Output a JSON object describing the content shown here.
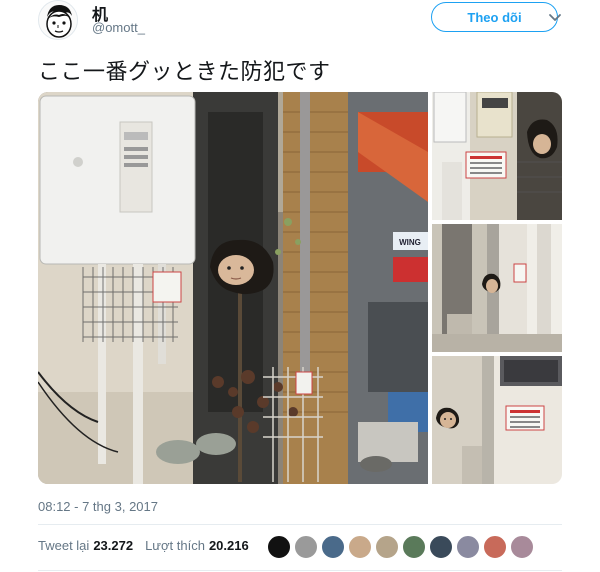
{
  "user": {
    "display_name": "机",
    "handle": "@omott_",
    "avatar_icon": "cartoon-face-avatar"
  },
  "header": {
    "follow_label": "Theo dõi",
    "menu_icon": "chevron-down-icon"
  },
  "tweet": {
    "text": "ここ一番グッときた防犯です",
    "timestamp": "08:12 - 7 thg 3, 2017"
  },
  "media": {
    "sign_text": "WING"
  },
  "stats": {
    "retweets_label": "Tweet lại",
    "retweets_count": "23.272",
    "likes_label": "Lượt thích",
    "likes_count": "20.216"
  },
  "likers": [
    {
      "name": "liker-avatar-1",
      "color": "#111111"
    },
    {
      "name": "liker-avatar-2",
      "color": "#9a9a9a"
    },
    {
      "name": "liker-avatar-3",
      "color": "#4a6a8a"
    },
    {
      "name": "liker-avatar-4",
      "color": "#c9a98a"
    },
    {
      "name": "liker-avatar-5",
      "color": "#b5a48a"
    },
    {
      "name": "liker-avatar-6",
      "color": "#5a7a5a"
    },
    {
      "name": "liker-avatar-7",
      "color": "#3a4a5a"
    },
    {
      "name": "liker-avatar-8",
      "color": "#8a8aa0"
    },
    {
      "name": "liker-avatar-9",
      "color": "#c86a5a"
    },
    {
      "name": "liker-avatar-10",
      "color": "#a88a9a"
    }
  ],
  "colors": {
    "accent": "#1da1f2",
    "secondary_text": "#657786",
    "primary_text": "#14171a"
  }
}
